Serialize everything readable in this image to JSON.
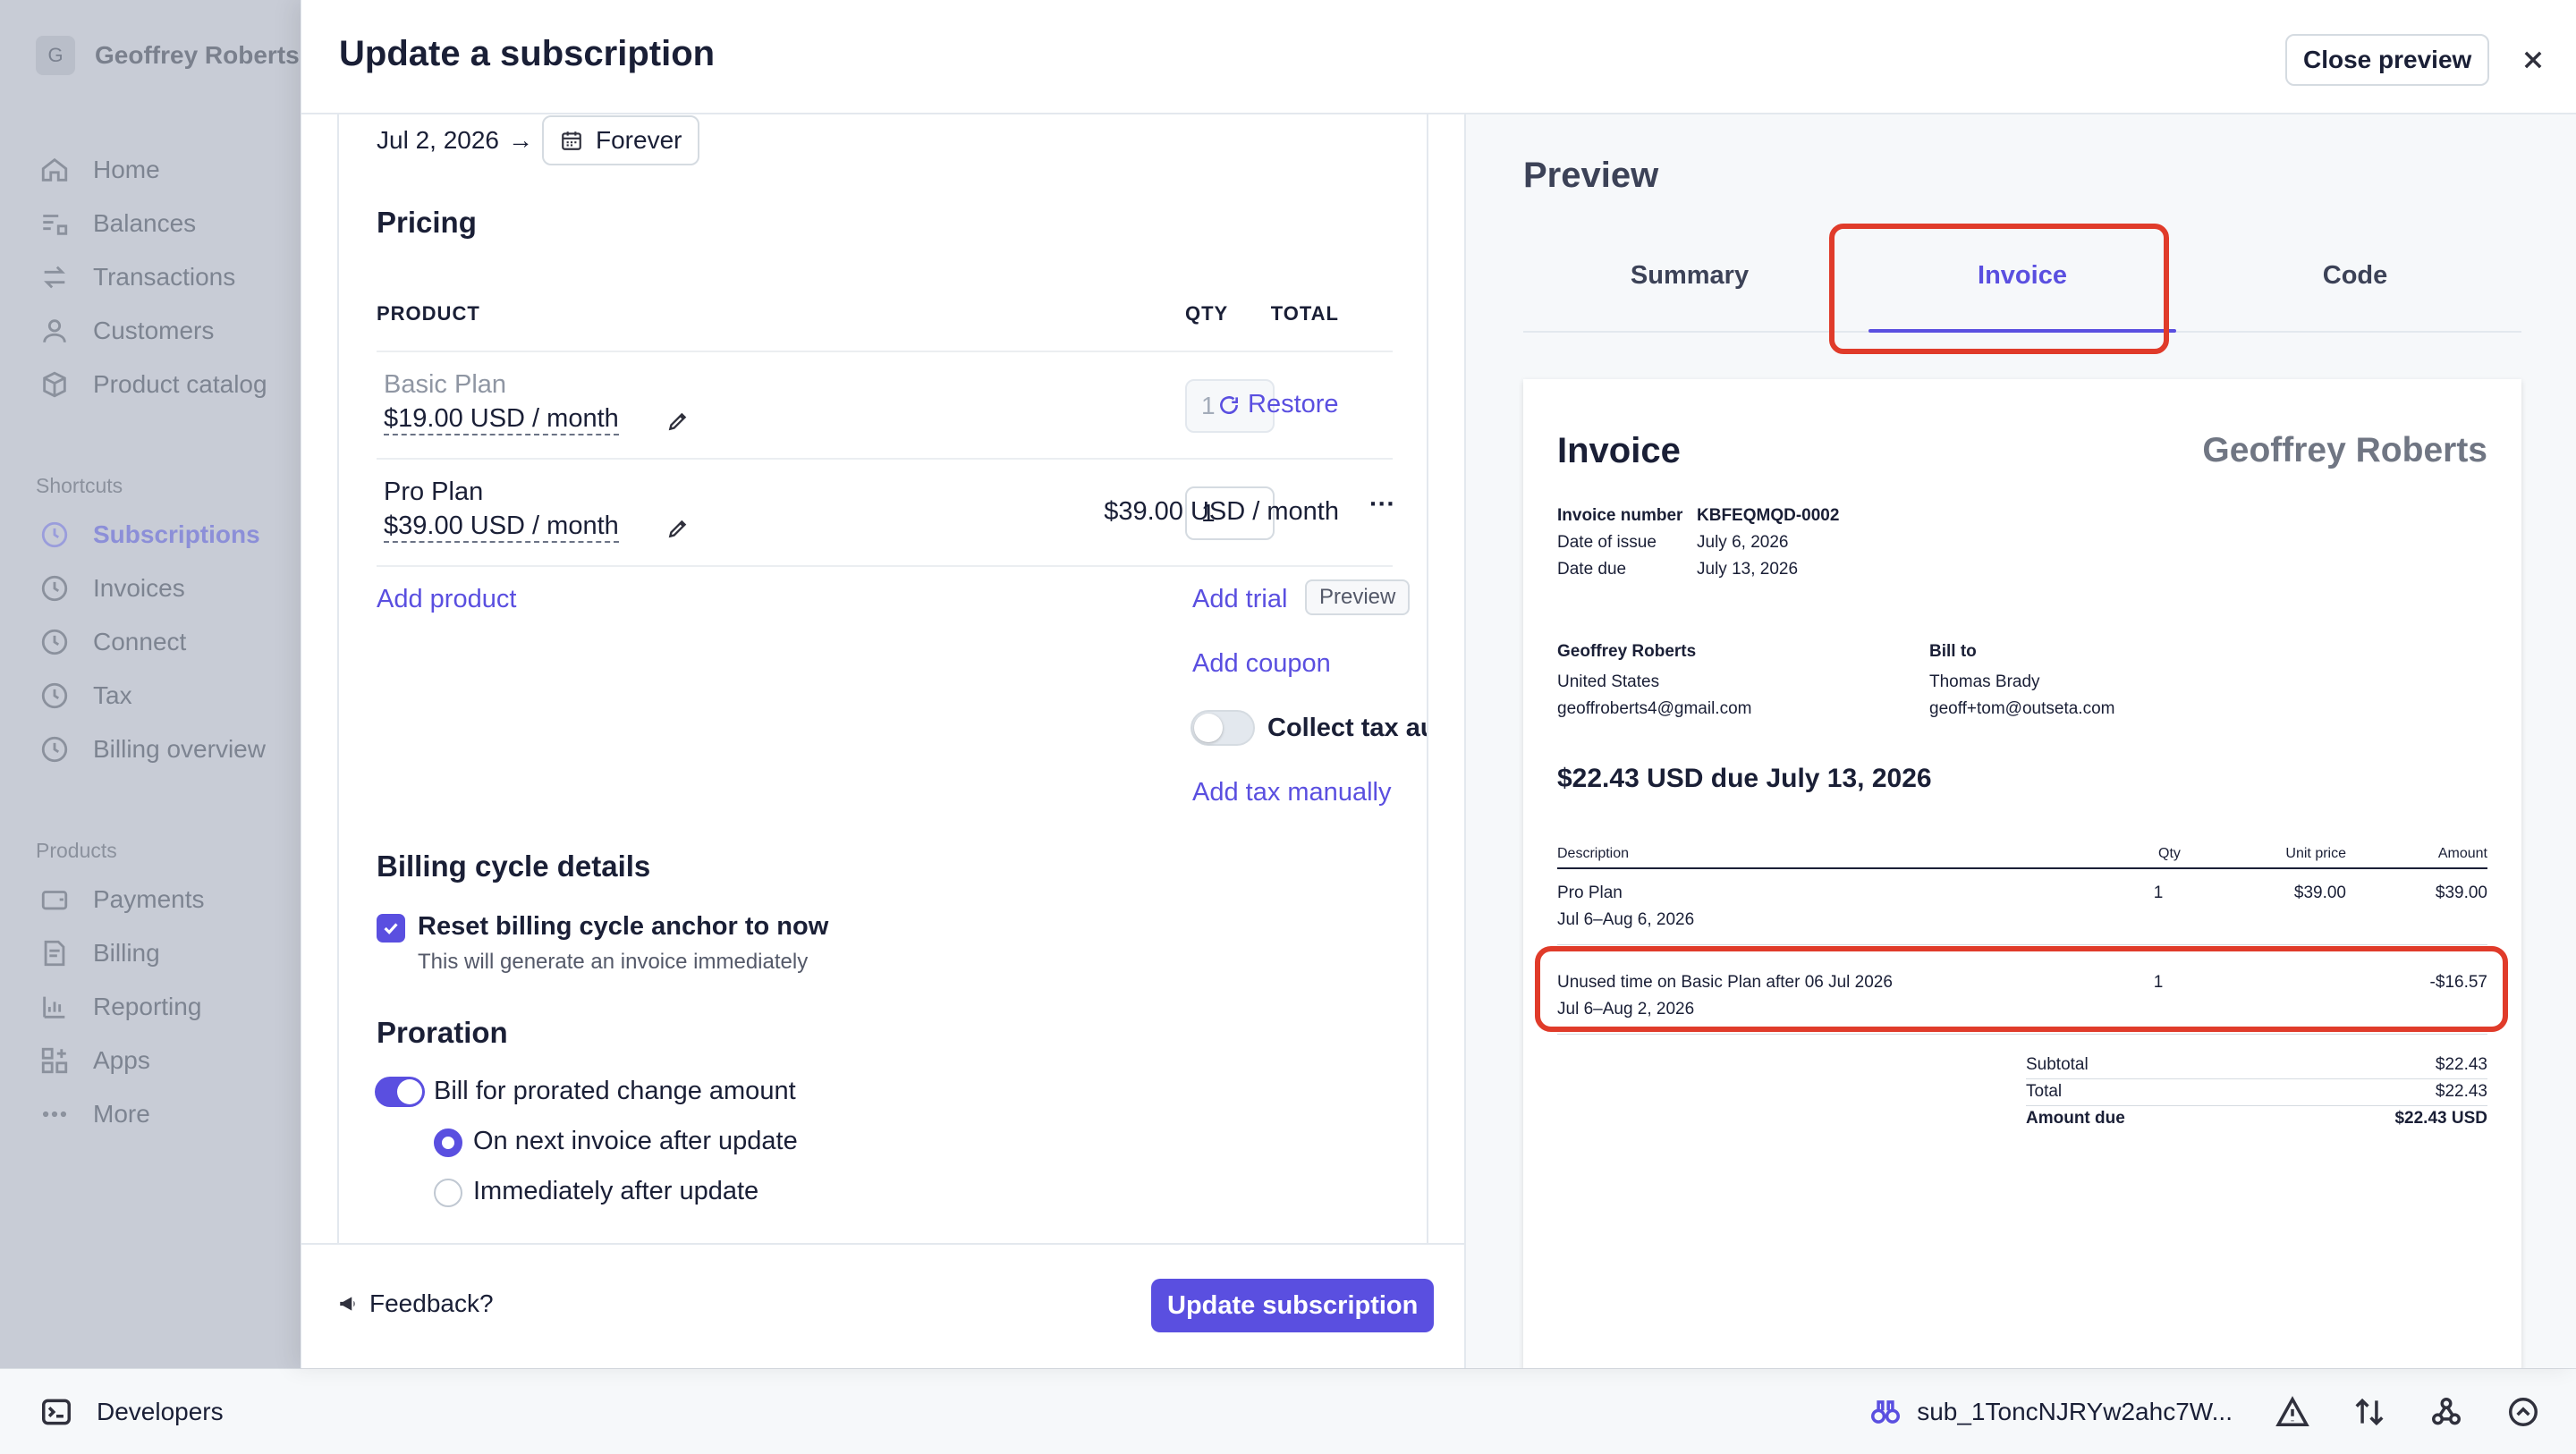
{
  "background": {
    "account": {
      "initial": "G",
      "name": "Geoffrey Roberts"
    },
    "nav": [
      {
        "label": "Home",
        "icon": "home-icon"
      },
      {
        "label": "Balances",
        "icon": "balances-icon"
      },
      {
        "label": "Transactions",
        "icon": "transactions-icon"
      },
      {
        "label": "Customers",
        "icon": "customers-icon"
      },
      {
        "label": "Product catalog",
        "icon": "box-icon"
      }
    ],
    "shortcuts_title": "Shortcuts",
    "shortcuts": [
      {
        "label": "Subscriptions",
        "active": true
      },
      {
        "label": "Invoices"
      },
      {
        "label": "Connect"
      },
      {
        "label": "Tax"
      },
      {
        "label": "Billing overview"
      }
    ],
    "products_title": "Products",
    "products": [
      {
        "label": "Payments",
        "icon": "wallet-icon"
      },
      {
        "label": "Billing",
        "icon": "billing-icon"
      },
      {
        "label": "Reporting",
        "icon": "chart-icon"
      },
      {
        "label": "Apps",
        "icon": "apps-icon"
      },
      {
        "label": "More",
        "icon": "more-icon"
      }
    ]
  },
  "devbar": {
    "developers_label": "Developers",
    "subscription_id": "sub_1ToncNJRYw2ahc7W..."
  },
  "modal": {
    "title": "Update a subscription",
    "close_preview": "Close preview",
    "form": {
      "start_date": "Jul 2, 2026",
      "arrow": "→",
      "end_label": "Forever",
      "pricing_title": "Pricing",
      "columns": {
        "product": "PRODUCT",
        "qty": "QTY",
        "total": "TOTAL"
      },
      "items": [
        {
          "name": "Basic Plan",
          "price": "$19.00 USD / month",
          "qty": "1",
          "action": "Restore"
        },
        {
          "name": "Pro Plan",
          "price": "$39.00 USD / month",
          "qty": "1",
          "total": "$39.00 USD / month",
          "more": "···"
        }
      ],
      "add_product": "Add product",
      "add_trial": "Add trial",
      "preview_badge": "Preview",
      "add_coupon": "Add coupon",
      "collect_tax": "Collect tax automatically",
      "add_tax": "Add tax manually",
      "billing_cycle_title": "Billing cycle details",
      "reset_anchor": "Reset billing cycle anchor to now",
      "reset_anchor_help": "This will generate an invoice immediately",
      "proration_title": "Proration",
      "bill_prorated": "Bill for prorated change amount",
      "option_next": "On next invoice after update",
      "option_immediate": "Immediately after update"
    },
    "footer": {
      "feedback": "Feedback?",
      "update_button": "Update subscription"
    },
    "preview": {
      "title": "Preview",
      "tabs": [
        "Summary",
        "Invoice",
        "Code"
      ],
      "active_tab": "Invoice",
      "invoice": {
        "title": "Invoice",
        "company": "Geoffrey Roberts",
        "meta": [
          {
            "label": "Invoice number",
            "value": "KBFEQMQD-0002"
          },
          {
            "label": "Date of issue",
            "value": "July 6, 2026"
          },
          {
            "label": "Date due",
            "value": "July 13, 2026"
          }
        ],
        "from": {
          "name": "Geoffrey Roberts",
          "country": "United States",
          "email": "geoffroberts4@gmail.com"
        },
        "bill_to": {
          "label": "Bill to",
          "name": "Thomas Brady",
          "email": "geoff+tom@outseta.com"
        },
        "amount_due_heading": "$22.43 USD due July 13, 2026",
        "table_headers": {
          "description": "Description",
          "qty": "Qty",
          "unit_price": "Unit price",
          "amount": "Amount"
        },
        "lines": [
          {
            "description": "Pro Plan",
            "period": "Jul 6–Aug 6, 2026",
            "qty": "1",
            "unit_price": "$39.00",
            "amount": "$39.00"
          },
          {
            "description": "Unused time on Basic Plan after 06 Jul 2026",
            "period": "Jul 6–Aug 2, 2026",
            "qty": "1",
            "unit_price": "",
            "amount": "-$16.57"
          }
        ],
        "totals": [
          {
            "label": "Subtotal",
            "value": "$22.43"
          },
          {
            "label": "Total",
            "value": "$22.43"
          },
          {
            "label": "Amount due",
            "value": "$22.43 USD",
            "bold": true
          }
        ]
      }
    }
  },
  "colors": {
    "accent": "#5a4fe0",
    "highlight": "#e03b2a"
  }
}
